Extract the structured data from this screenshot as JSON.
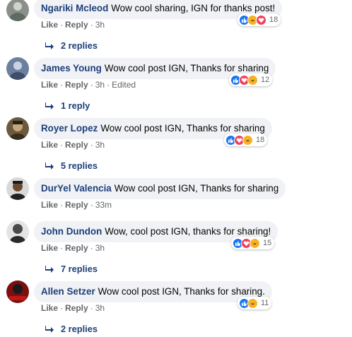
{
  "comments": [
    {
      "author": "Ngariki Mcleod",
      "text": "Wow cool sharing, IGN for thanks post!",
      "like": "Like",
      "reply": "Reply",
      "time": "3h",
      "edited": "",
      "reactions": [
        "like",
        "haha",
        "love"
      ],
      "reaction_count": "18",
      "replies": "2 replies"
    },
    {
      "author": "James Young",
      "text": "Wow cool post IGN, Thanks for sharing",
      "like": "Like",
      "reply": "Reply",
      "time": "3h",
      "edited": "Edited",
      "reactions": [
        "like",
        "love",
        "haha"
      ],
      "reaction_count": "12",
      "replies": "1 reply"
    },
    {
      "author": "Royer Lopez",
      "text": "Wow cool post IGN, Thanks for sharing",
      "like": "Like",
      "reply": "Reply",
      "time": "3h",
      "edited": "",
      "reactions": [
        "like",
        "love",
        "haha"
      ],
      "reaction_count": "18",
      "replies": "5 replies"
    },
    {
      "author": "DurYel Valencia",
      "text": "Wow cool post IGN, Thanks for sharing",
      "like": "Like",
      "reply": "Reply",
      "time": "33m",
      "edited": "",
      "reactions": [],
      "reaction_count": "",
      "replies": ""
    },
    {
      "author": "John Dundon",
      "text": "Wow, cool post IGN, thanks for sharing!",
      "like": "Like",
      "reply": "Reply",
      "time": "3h",
      "edited": "",
      "reactions": [
        "like",
        "love",
        "haha"
      ],
      "reaction_count": "15",
      "replies": "7 replies"
    },
    {
      "author": "Allen Setzer",
      "text": "Wow cool post IGN, Thanks for sharing.",
      "like": "Like",
      "reply": "Reply",
      "time": "3h",
      "edited": "",
      "reactions": [
        "like",
        "haha"
      ],
      "reaction_count": "11",
      "replies": "2 replies"
    }
  ],
  "colors": {
    "author": "#1d3f7a",
    "bubble": "#f0f2f5",
    "meta": "#65676b",
    "like": "#1877f2",
    "love": "#f33e58",
    "haha": "#f7b125"
  }
}
